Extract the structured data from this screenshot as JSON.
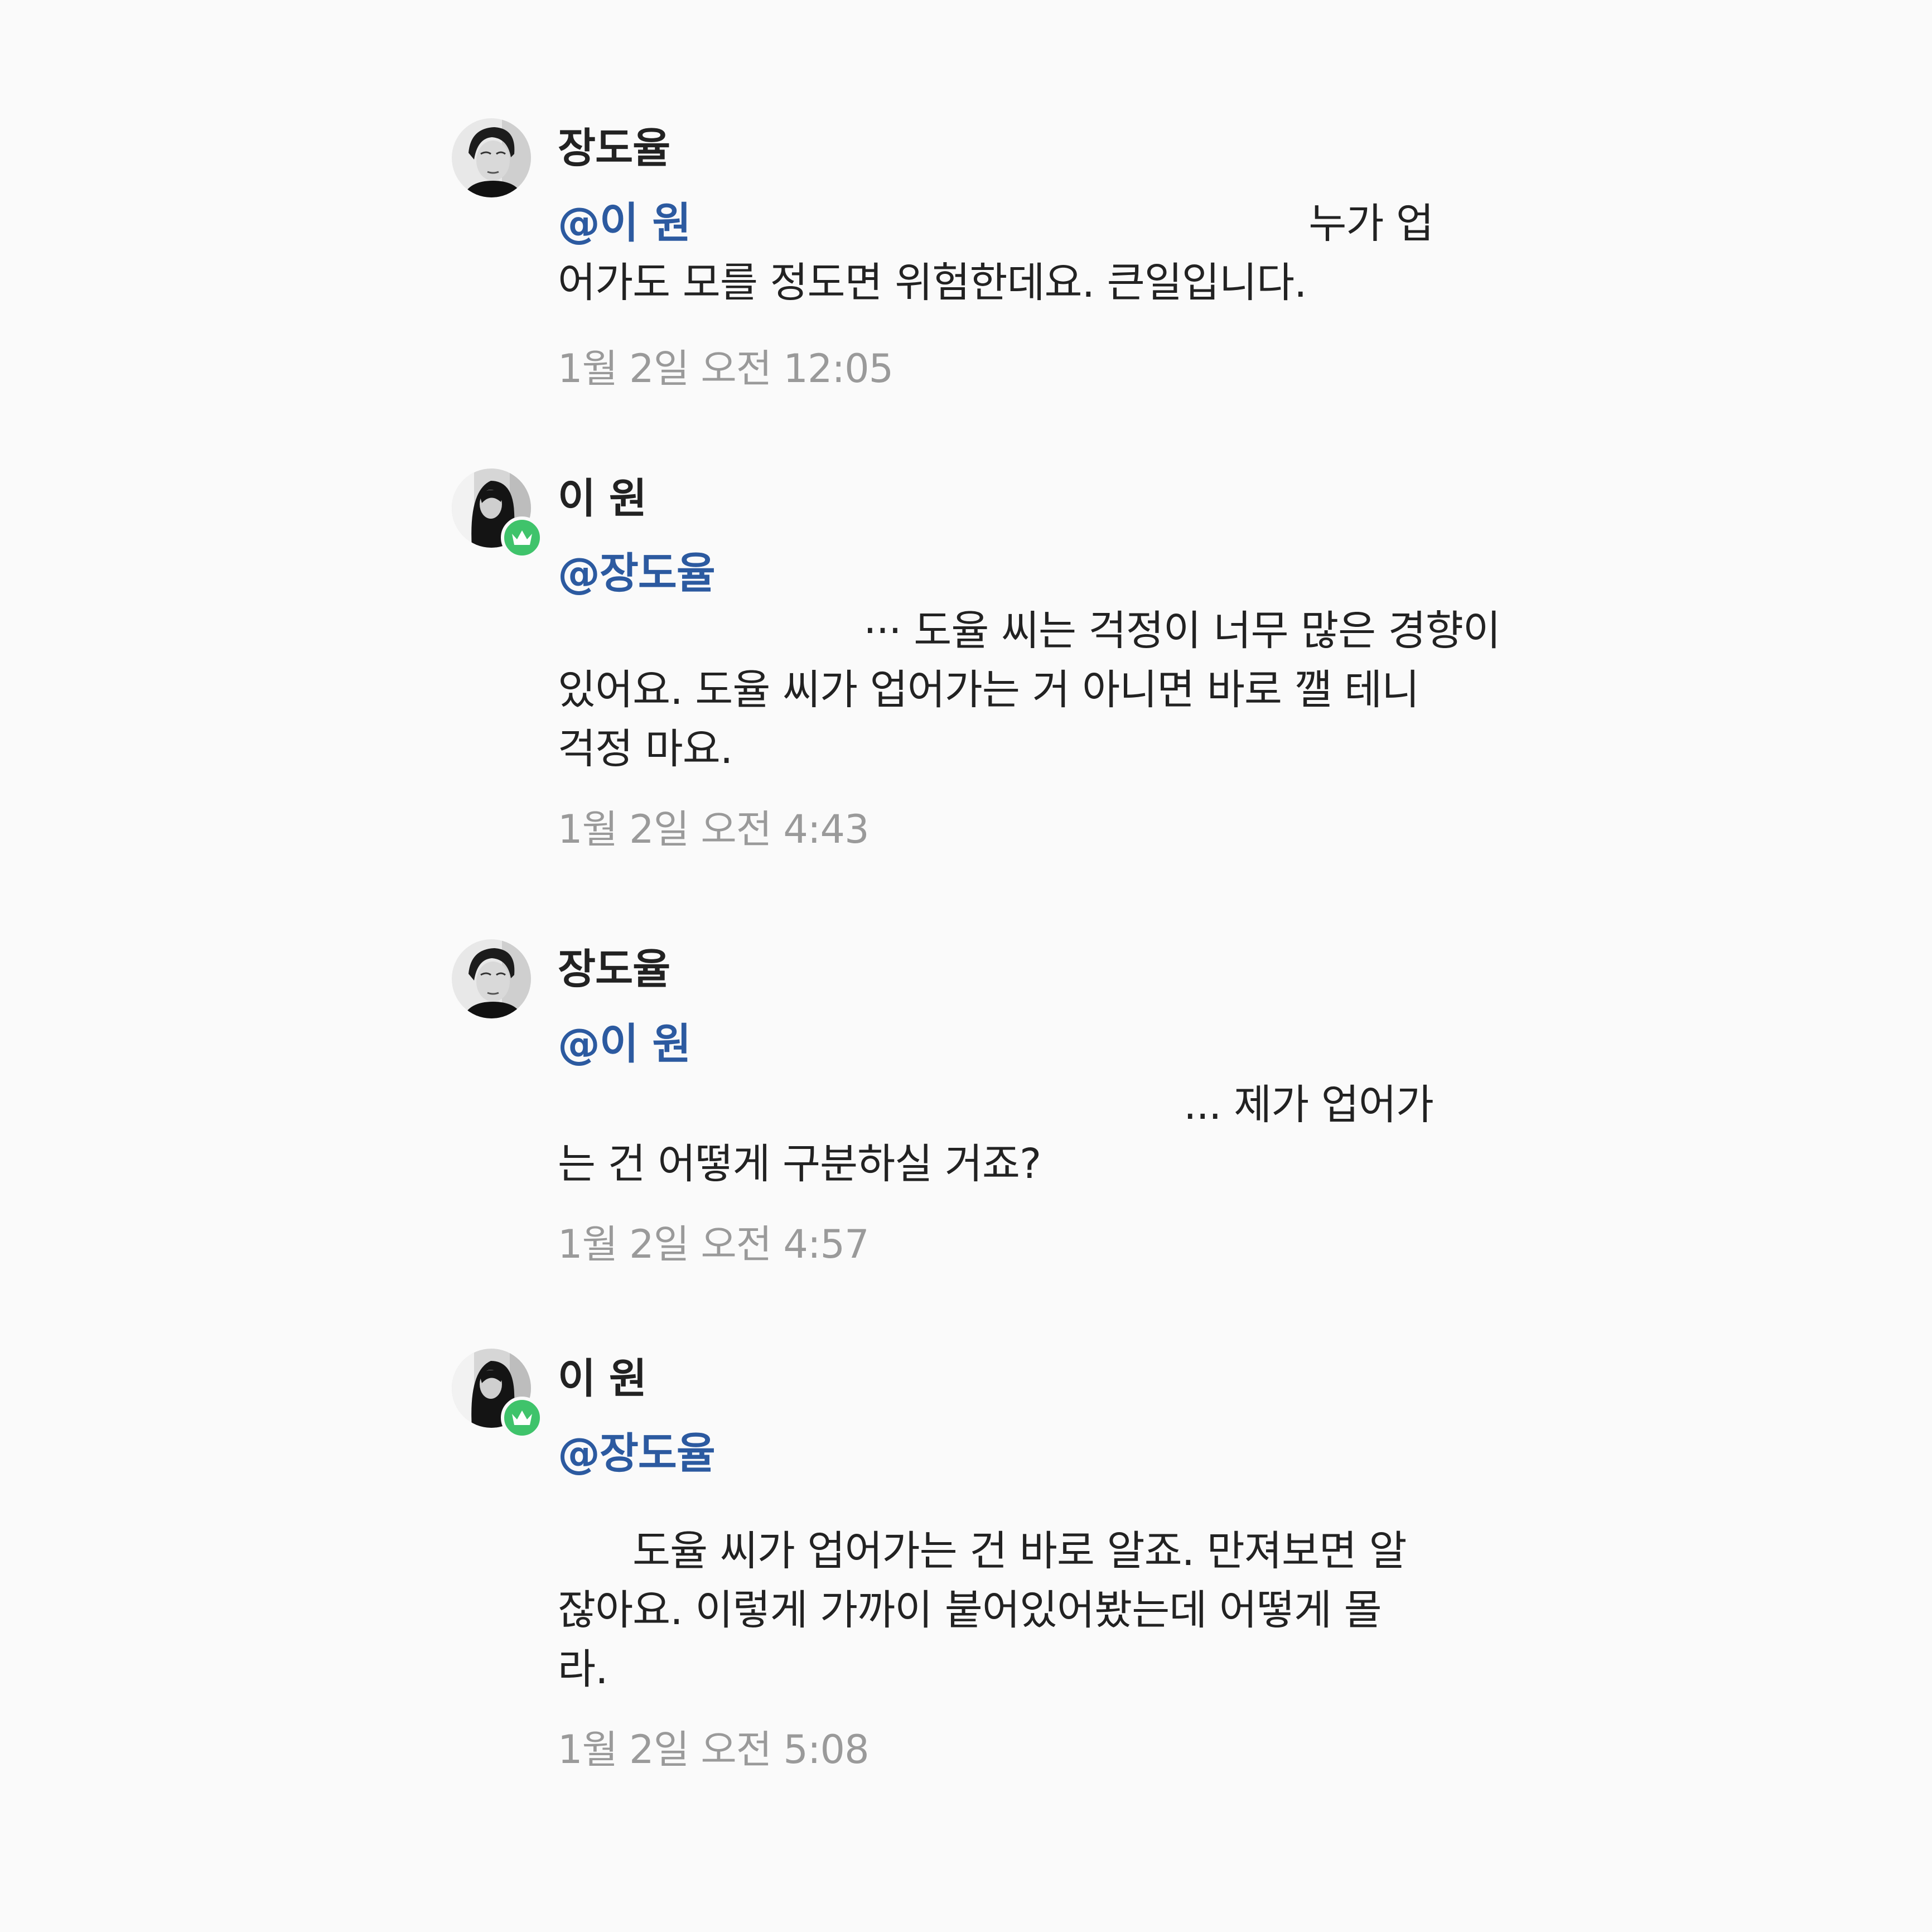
{
  "messages": [
    {
      "author": "장도율",
      "mention": "@이 원",
      "lines": [
        "누가 업",
        "어가도 모를 정도면 위험한데요. 큰일입니다."
      ],
      "time": "1월 2일 오전 12:05",
      "avatar_icon": "male-portrait-avatar",
      "badge": false
    },
    {
      "author": "이 원",
      "mention": "@장도율",
      "lines": [
        "··· 도율 씨는 걱정이 너무 많은 경향이",
        "있어요. 도율 씨가 업어가는 거 아니면 바로 깰 테니",
        "걱정 마요."
      ],
      "time": "1월 2일 오전 4:43",
      "avatar_icon": "female-portrait-avatar",
      "badge": true
    },
    {
      "author": "장도율",
      "mention": "@이 원",
      "lines": [
        "... 제가 업어가",
        "는 건 어떻게 구분하실 거죠?"
      ],
      "time": "1월 2일 오전 4:57",
      "avatar_icon": "male-portrait-avatar",
      "badge": false
    },
    {
      "author": "이 원",
      "mention": "@장도율",
      "lines": [
        "도율 씨가 업어가는 건 바로 알죠. 만져보면 알",
        "잖아요. 이렇게 가까이 붙어있어봤는데 어떻게 몰",
        "라."
      ],
      "time": "1월 2일 오전 5:08",
      "avatar_icon": "female-portrait-avatar",
      "badge": true
    }
  ],
  "colors": {
    "background": "#fafafa",
    "mention": "#2c5aa0",
    "text": "#222222",
    "timestamp": "#9a9a9a",
    "badge": "#3fc36b"
  }
}
